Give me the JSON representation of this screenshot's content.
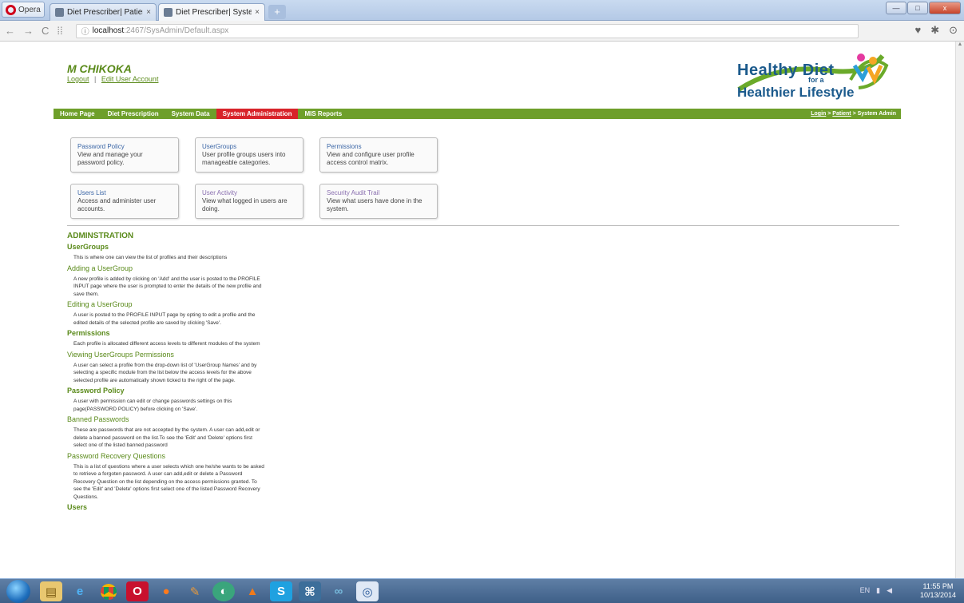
{
  "browser": {
    "opera_label": "Opera",
    "tabs": [
      {
        "title": "Diet Prescriber| Patient Se",
        "close": "×"
      },
      {
        "title": "Diet Prescriber| System Ad",
        "close": "×"
      }
    ],
    "new_tab": "+",
    "window": {
      "minimize": "—",
      "maximize": "□",
      "close": "x"
    },
    "address": {
      "host": "localhost",
      "path": ":2467/SysAdmin/Default.aspx"
    }
  },
  "header": {
    "username": "M CHIKOKA",
    "logout": "Logout",
    "divider": "|",
    "edit_account": "Edit User Account",
    "logo": {
      "line1": "Healthy Diet",
      "line2": "for a",
      "line3": "Healthier Lifestyle"
    }
  },
  "menu": {
    "items": [
      "Home Page",
      "Diet Prescription",
      "System Data",
      "System Administration",
      "MIS Reports"
    ],
    "active_index": 3,
    "breadcrumb": {
      "login": "Login",
      "sep1": " > ",
      "patient": "Patient",
      "sep2": " > ",
      "current": "System Admin"
    }
  },
  "tiles": [
    {
      "title": "Password Policy",
      "desc": "View and manage your password policy."
    },
    {
      "title": "UserGroups",
      "desc": "User profile groups users into manageable categories."
    },
    {
      "title": "Permissions",
      "desc": "View and configure user profile access control matrix."
    },
    {
      "title": "Users List",
      "desc": "Access and administer user accounts."
    },
    {
      "title": "User Activity",
      "desc": "View what logged in users are doing."
    },
    {
      "title": "Security Audit Trail",
      "desc": "View what users have done in the system."
    }
  ],
  "help": {
    "heading": "ADMINSTRATION",
    "sections": [
      {
        "title": "UserGroups",
        "body": "This is where one can view the list of profiles and their descriptions"
      },
      {
        "title": "Adding a UserGroup",
        "body": "A new profile is added by clicking on 'Add' and the user is posted to the PROFILE INPUT page where the user is prompted to enter the details of the new profile and save them."
      },
      {
        "title": "Editing a UserGroup",
        "body": "A user is posted to the PROFILE INPUT page by opting to edit a profile and the edited details of the selected profile are saved by clicking 'Save'."
      },
      {
        "title": "Permissions",
        "body": "Each profile is allocated different access levels to different modules of the system"
      },
      {
        "title": "Viewing UserGroups Permissions",
        "body": "A user can select a profile from the drop-down list of 'UserGroup Names' and by selecting a specific module from the list below the access levels for the above selected profile are automatically shown ticked to the right of the page."
      },
      {
        "title": "Password Policy",
        "body": "A user with permission can edit or change passwords settings on this page(PASSWORD POLICY) before clicking on 'Save'."
      },
      {
        "title": "Banned Passwords",
        "body": "These are passwords that are not accepted by the system. A user can add,edit or delete a banned password on the list.To see the 'Edit' and 'Delete' options first select one of the listed banned password"
      },
      {
        "title": "Password Recovery Questions",
        "body": "This is a list of questions where a user selects which one he/she wants to be asked to retrieve a forgoten password. A user can add,edit or delete a Password Recovery Question on the list depending on the access permissions granted. To see the 'Edit' and 'Delete' options first select one of the listed Password Recovery Questions."
      },
      {
        "title": "Users",
        "body": ""
      }
    ]
  },
  "taskbar": {
    "tray_lang": "EN",
    "time": "11:55 PM",
    "date": "10/13/2014"
  }
}
